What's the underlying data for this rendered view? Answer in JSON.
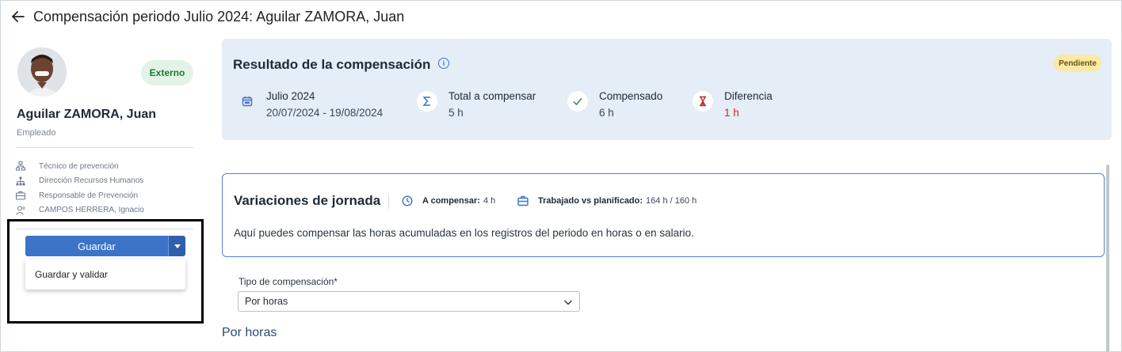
{
  "header": {
    "title": "Compensación periodo Julio 2024: Aguilar ZAMORA, Juan"
  },
  "profile": {
    "badge": "Externo",
    "name": "Aguilar ZAMORA, Juan",
    "role": "Empleado",
    "info": [
      {
        "icon": "org-chart-icon",
        "label": "Técnico de prevención"
      },
      {
        "icon": "hierarchy-icon",
        "label": "Dirección Recursos Humanos"
      },
      {
        "icon": "briefcase-icon",
        "label": "Responsable de Prevención"
      },
      {
        "icon": "user-manager-icon",
        "label": "CAMPOS HERRERA, Ignacio"
      }
    ]
  },
  "actions": {
    "save_label": "Guardar",
    "menu_items": [
      "Guardar y validar"
    ]
  },
  "result": {
    "title": "Resultado de la compensación",
    "status": "Pendiente",
    "metrics": [
      {
        "icon": "calendar-icon",
        "label": "Julio 2024",
        "value": "20/07/2024 - 19/08/2024"
      },
      {
        "icon": "sigma-icon",
        "label": "Total a compensar",
        "value": "5 h"
      },
      {
        "icon": "check-icon",
        "label": "Compensado",
        "value": "6 h"
      },
      {
        "icon": "hourglass-icon",
        "label": "Diferencia",
        "value": "1 h"
      }
    ]
  },
  "variations": {
    "title": "Variaciones de jornada",
    "to_compensate_label": "A compensar:",
    "to_compensate_value": "4 h",
    "worked_label": "Trabajado vs planificado:",
    "worked_value": "164 h / 160 h",
    "description": "Aquí puedes compensar las horas acumuladas en los registros del periodo en horas o en salario."
  },
  "form": {
    "compensation_type_label": "Tipo de compensación*",
    "compensation_type_value": "Por horas",
    "section_heading": "Por horas"
  },
  "colors": {
    "accent": "#3b73c8",
    "danger": "#c62828",
    "pending": "#fbe9a6",
    "external": "#e3f4e6"
  }
}
